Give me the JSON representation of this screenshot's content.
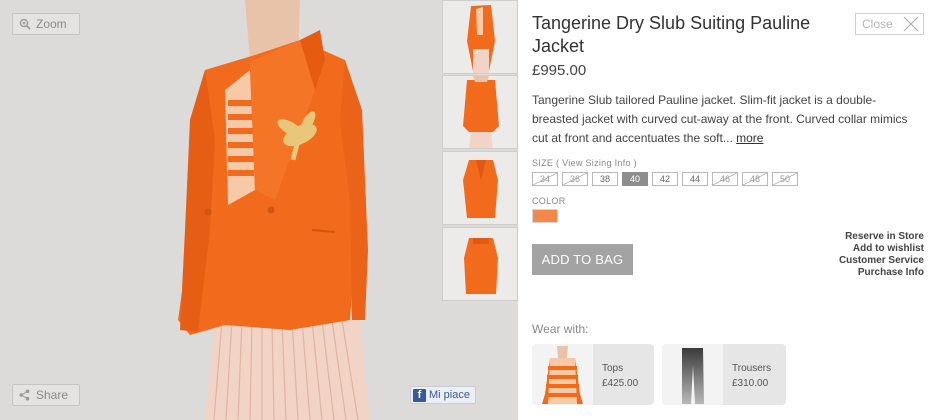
{
  "viewer": {
    "zoom_label": "Zoom",
    "share_label": "Share",
    "fb_label": "Mi piace",
    "thumbnails": [
      "thumb-front-open",
      "thumb-back",
      "thumb-front-closed",
      "thumb-back-flat"
    ]
  },
  "product": {
    "title": "Tangerine Dry Slub Suiting Pauline Jacket",
    "price": "£995.00",
    "description": "Tangerine Slub tailored Pauline jacket. Slim-fit jacket is a double-breasted jacket with curved cut-away at the front. Curved collar mimics cut at front and accentuates the soft...",
    "more_label": "more",
    "close_label": "Close"
  },
  "size": {
    "label": "SIZE",
    "sizing_link": "( View Sizing Info )",
    "options": [
      {
        "value": "34",
        "available": false
      },
      {
        "value": "36",
        "available": false
      },
      {
        "value": "38",
        "available": true
      },
      {
        "value": "40",
        "available": true,
        "selected": true
      },
      {
        "value": "42",
        "available": true
      },
      {
        "value": "44",
        "available": true
      },
      {
        "value": "46",
        "available": false
      },
      {
        "value": "48",
        "available": false
      },
      {
        "value": "50",
        "available": false
      }
    ]
  },
  "color": {
    "label": "COLOR",
    "swatch": "#f4884a"
  },
  "actions": {
    "add_to_bag": "ADD TO BAG",
    "links": [
      "Reserve in Store",
      "Add to wishlist",
      "Customer Service",
      "Purchase Info"
    ]
  },
  "wear_with": {
    "label": "Wear with:",
    "items": [
      {
        "category": "Tops",
        "price": "£425.00"
      },
      {
        "category": "Trousers",
        "price": "£310.00"
      }
    ]
  },
  "colors": {
    "jacket": "#f26a1b",
    "background": "#dcdbd9",
    "button": "#a3a3a3"
  }
}
